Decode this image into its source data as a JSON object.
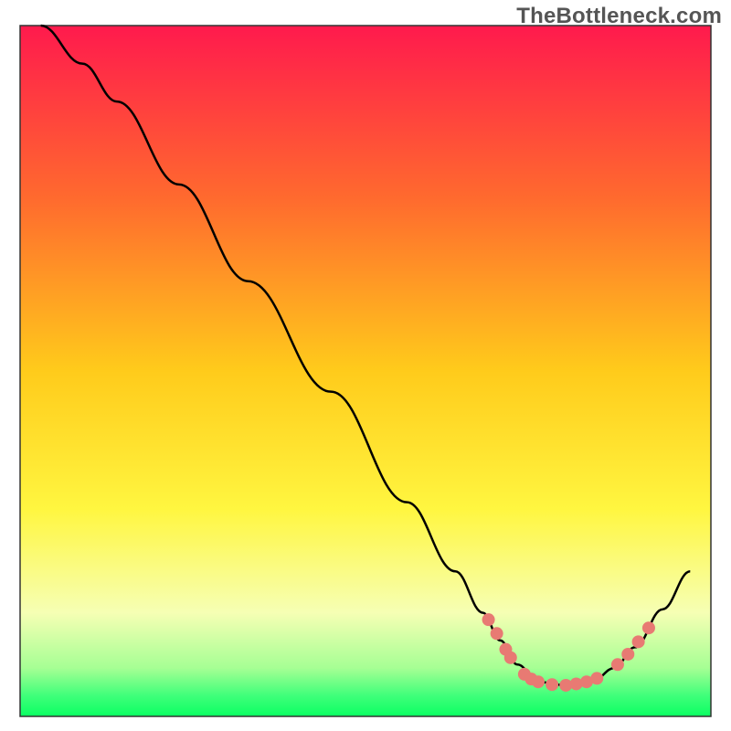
{
  "watermark": "TheBottleneck.com",
  "chart_data": {
    "type": "line",
    "title": "",
    "xlabel": "",
    "ylabel": "",
    "xlim": [
      0,
      100
    ],
    "ylim": [
      0,
      100
    ],
    "grid": false,
    "legend": false,
    "background_gradient_stops": [
      {
        "offset": 0.0,
        "color": "#ff1a4d"
      },
      {
        "offset": 0.25,
        "color": "#ff6a2e"
      },
      {
        "offset": 0.5,
        "color": "#ffcb1b"
      },
      {
        "offset": 0.7,
        "color": "#fff640"
      },
      {
        "offset": 0.85,
        "color": "#f6ffb4"
      },
      {
        "offset": 0.93,
        "color": "#a6ff94"
      },
      {
        "offset": 0.97,
        "color": "#3fff7a"
      },
      {
        "offset": 1.0,
        "color": "#0bff62"
      }
    ],
    "curve_points": [
      {
        "x": 3.0,
        "y": 100.0
      },
      {
        "x": 9.0,
        "y": 94.5
      },
      {
        "x": 14.0,
        "y": 89.0
      },
      {
        "x": 23.0,
        "y": 77.0
      },
      {
        "x": 33.0,
        "y": 63.0
      },
      {
        "x": 45.0,
        "y": 47.0
      },
      {
        "x": 56.0,
        "y": 31.0
      },
      {
        "x": 63.0,
        "y": 21.0
      },
      {
        "x": 67.0,
        "y": 15.0
      },
      {
        "x": 69.5,
        "y": 11.0
      },
      {
        "x": 72.0,
        "y": 7.5
      },
      {
        "x": 75.0,
        "y": 5.0
      },
      {
        "x": 79.0,
        "y": 4.5
      },
      {
        "x": 83.0,
        "y": 5.2
      },
      {
        "x": 86.0,
        "y": 7.0
      },
      {
        "x": 89.0,
        "y": 10.0
      },
      {
        "x": 93.0,
        "y": 15.5
      },
      {
        "x": 97.0,
        "y": 21.0
      }
    ],
    "markers": [
      {
        "x": 67.8,
        "y": 14.0
      },
      {
        "x": 69.0,
        "y": 12.0
      },
      {
        "x": 70.3,
        "y": 9.7
      },
      {
        "x": 71.0,
        "y": 8.5
      },
      {
        "x": 73.0,
        "y": 6.1
      },
      {
        "x": 74.0,
        "y": 5.4
      },
      {
        "x": 75.0,
        "y": 5.0
      },
      {
        "x": 77.0,
        "y": 4.6
      },
      {
        "x": 79.0,
        "y": 4.5
      },
      {
        "x": 80.5,
        "y": 4.7
      },
      {
        "x": 82.0,
        "y": 5.0
      },
      {
        "x": 83.5,
        "y": 5.5
      },
      {
        "x": 86.5,
        "y": 7.5
      },
      {
        "x": 88.0,
        "y": 9.0
      },
      {
        "x": 89.5,
        "y": 10.8
      },
      {
        "x": 91.0,
        "y": 12.8
      }
    ],
    "curve_color": "#000000",
    "marker_color": "#e87a73",
    "marker_radius": 7
  }
}
